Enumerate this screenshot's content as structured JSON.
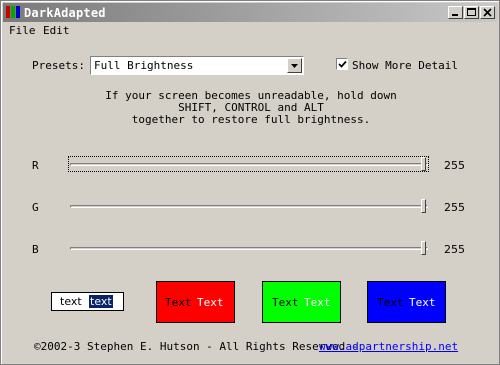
{
  "window": {
    "title": "DarkAdapted",
    "controls": [
      "minimize",
      "maximize",
      "close"
    ]
  },
  "menu": {
    "items": [
      "File",
      "Edit"
    ]
  },
  "presets": {
    "label": "Presets:",
    "selected": "Full Brightness"
  },
  "show_more": {
    "label": "Show More Detail",
    "checked": true
  },
  "info": {
    "line1": "If your screen becomes unreadable, hold down",
    "line2": "SHIFT, CONTROL and ALT",
    "line3": "together to restore full brightness."
  },
  "sliders": [
    {
      "label": "R",
      "value": "255",
      "level": 1.0
    },
    {
      "label": "G",
      "value": "255",
      "level": 1.0
    },
    {
      "label": "B",
      "value": "255",
      "level": 1.0
    }
  ],
  "sample": {
    "normal": "text",
    "selected": "text"
  },
  "swatches": [
    {
      "text1": "Text",
      "text2": "Text",
      "bg": "#ff0000",
      "fg1": "#000000",
      "fg2": "#ffffff"
    },
    {
      "text1": "Text",
      "text2": "Text",
      "bg": "#00ff00",
      "fg1": "#000000",
      "fg2": "#ffffff"
    },
    {
      "text1": "Text",
      "text2": "Text",
      "bg": "#0000ff",
      "fg1": "#000000",
      "fg2": "#ffffff"
    }
  ],
  "footer": {
    "copyright": "©2002-3 Stephen E. Hutson - All Rights Reserved -",
    "link": "www.adpartnership.net"
  },
  "colors": {
    "face": "#d4d0c8",
    "title_start": "#7a7a7a",
    "title_end": "#c8c8c8",
    "link": "#0000ff",
    "selection": "#0a246a"
  }
}
